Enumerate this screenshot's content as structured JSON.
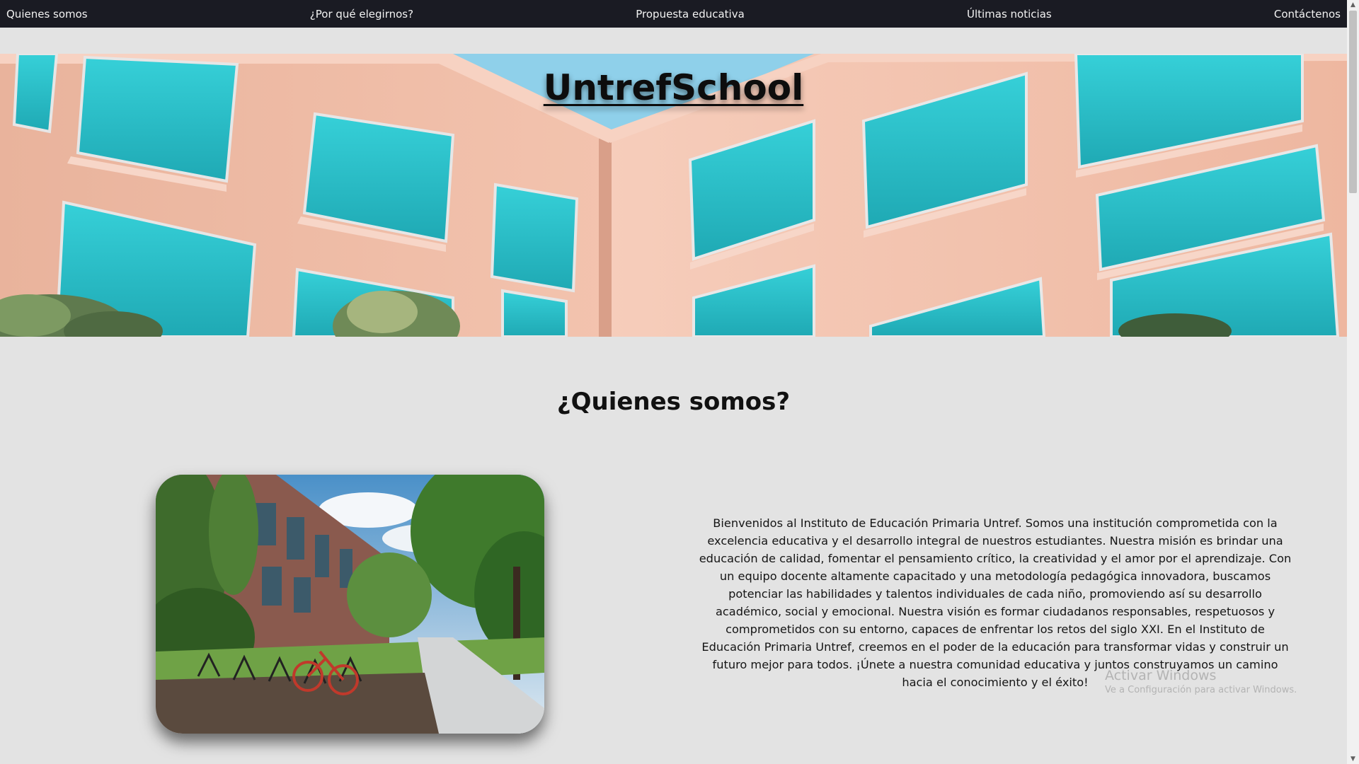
{
  "nav": {
    "items": [
      {
        "label": "Quienes somos"
      },
      {
        "label": "¿Por qué elegirnos?"
      },
      {
        "label": "Propuesta educativa"
      },
      {
        "label": "Últimas noticias"
      },
      {
        "label": "Contáctenos"
      }
    ]
  },
  "hero": {
    "title": "UntrefSchool"
  },
  "about": {
    "heading": "¿Quienes somos?",
    "text": "Bienvenidos al Instituto de Educación Primaria Untref. Somos una institución comprometida con la excelencia educativa y el desarrollo integral de nuestros estudiantes. Nuestra misión es brindar una educación de calidad, fomentar el pensamiento crítico, la creatividad y el amor por el aprendizaje. Con un equipo docente altamente capacitado y una metodología pedagógica innovadora, buscamos potenciar las habilidades y talentos individuales de cada niño, promoviendo así su desarrollo académico, social y emocional. Nuestra visión es formar ciudadanos responsables, respetuosos y comprometidos con su entorno, capaces de enfrentar los retos del siglo XXI. En el Instituto de Educación Primaria Untref, creemos en el poder de la educación para transformar vidas y construir un futuro mejor para todos. ¡Únete a nuestra comunidad educativa y juntos construyamos un camino hacia el conocimiento y el éxito!"
  },
  "watermark": {
    "title": "Activar Windows",
    "subtitle": "Ve a Configuración para activar Windows."
  },
  "colors": {
    "navbar_bg": "#1a1b23",
    "page_bg": "#e3e3e3",
    "building_wall": "#f0b9a4",
    "window_glass": "#2ec6cf"
  }
}
